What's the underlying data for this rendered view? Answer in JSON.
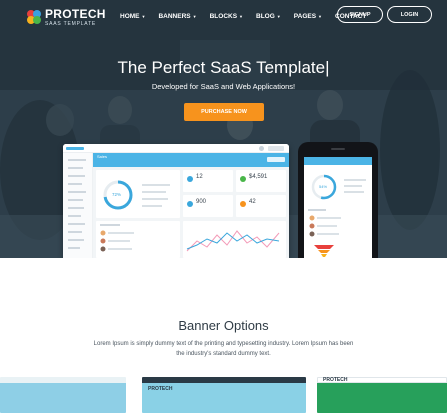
{
  "brand": {
    "name": "PROTECH",
    "tagline": "SAAS TEMPLATE"
  },
  "nav": {
    "items": [
      {
        "label": "HOME",
        "dropdown": true
      },
      {
        "label": "BANNERS",
        "dropdown": true
      },
      {
        "label": "BLOCKS",
        "dropdown": true
      },
      {
        "label": "BLOG",
        "dropdown": true
      },
      {
        "label": "PAGES",
        "dropdown": true
      },
      {
        "label": "CONTACT",
        "dropdown": false
      }
    ],
    "signup_label": "SIGNUP",
    "login_label": "LOGIN"
  },
  "hero": {
    "title": "The Perfect SaaS Template|",
    "subtitle": "Developed for SaaS and Web Applications!",
    "cta_label": "PURCHASE NOW"
  },
  "dashboard": {
    "header_label": "Sales",
    "donut_label": "72%",
    "stats": [
      "12",
      "$4,591",
      "900",
      "42"
    ],
    "phone_donut_label": "54%"
  },
  "section": {
    "title": "Banner Options",
    "text": "Lorem Ipsum is simply dummy text of the printing and typesetting industry. Lorem Ipsum has been the industry's standard dummy text."
  },
  "thumbnails": [
    {
      "logo": "",
      "bar_color": "#e9f2f5",
      "body_color": "#8ecfe6"
    },
    {
      "logo": "PROTECH",
      "bar_color": "#2a3a46",
      "body_color": "#8ad1e6"
    },
    {
      "logo": "PROTECH",
      "bar_color": "#ffffff",
      "body_color": "#27a05b"
    }
  ],
  "colors": {
    "accent": "#f7931d",
    "primary": "#4bb4e6"
  }
}
